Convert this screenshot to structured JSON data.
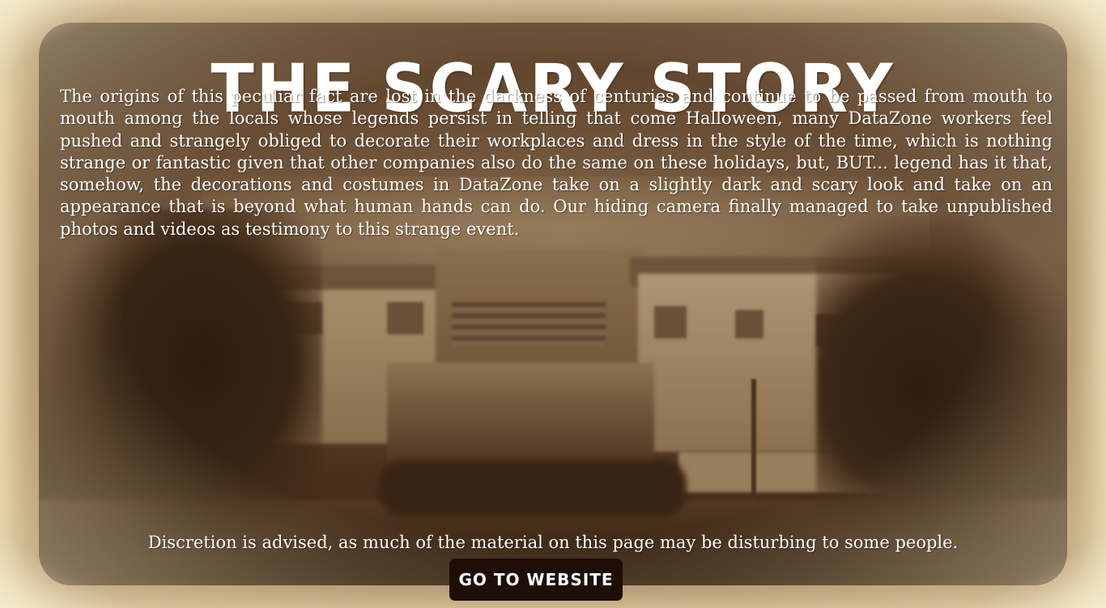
{
  "header": {
    "title": "THE SCARY STORY"
  },
  "story": {
    "text": "The origins of this peculiar fact are lost in the darkness of centuries and continue to be passed from mouth to mouth among the locals whose legends persist in telling that come Halloween, many DataZone workers feel pushed and strangely obliged to decorate their workplaces and dress in the style of the time, which is nothing strange or fantastic given that other companies also do the same on these holidays, but, BUT... legend has it that, somehow, the decorations and costumes in DataZone take on a slightly dark and scary look and take on an appearance that is beyond what human hands can do. Our hiding camera finally managed to take unpublished photos and videos as testimony to this strange event."
  },
  "footer": {
    "discretion": "Discretion is advised, as much of the material on this page may be disturbing to some people.",
    "cta_label": "GO TO WEBSITE"
  },
  "colors": {
    "text": "#ffffff",
    "button_bg": "#1e0e06",
    "paper": "#f2e6c2",
    "sepia_dark": "#3e2815"
  }
}
